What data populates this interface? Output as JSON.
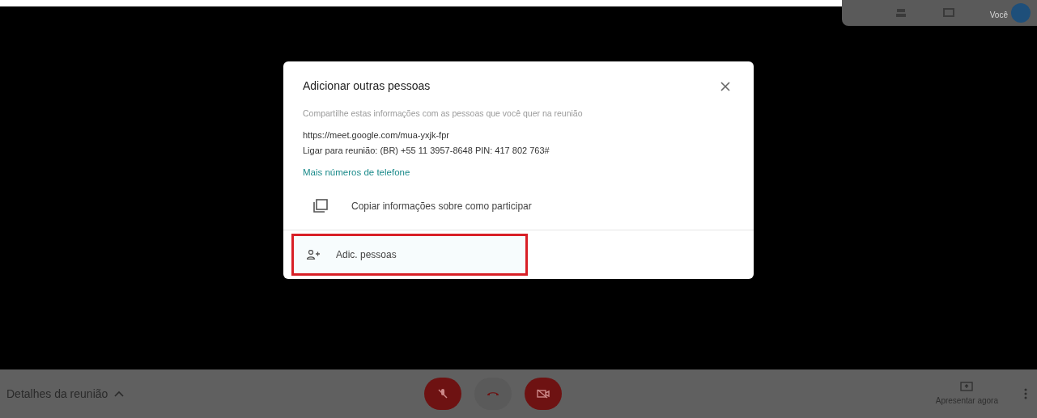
{
  "top_panel": {
    "self_label": "Você"
  },
  "dialog": {
    "title": "Adicionar outras pessoas",
    "description": "Compartilhe estas informações com as pessoas que você quer na reunião",
    "meeting_link": "https://meet.google.com/mua-yxjk-fpr",
    "dial_in": "Ligar para reunião: (BR) +55 11 3957-8648  PIN: 417 802 763#",
    "more_numbers_link": "Mais números de telefone",
    "copy_action": "Copiar informações sobre como participar",
    "add_people_action": {
      "label": "Adic. pessoas",
      "highlighted": true
    }
  },
  "bottom_bar": {
    "details": "Detalhes da reunião",
    "present": "Apresentar agora"
  }
}
